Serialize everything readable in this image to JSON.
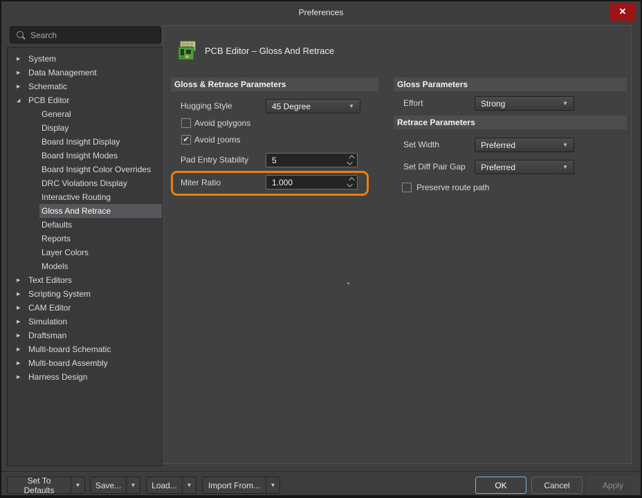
{
  "window": {
    "title": "Preferences"
  },
  "icons": {
    "close": "✕",
    "tree_collapsed": "▶",
    "tree_expanded": "◢",
    "dropdown_arrow": "▼",
    "check": "✔"
  },
  "colors": {
    "annotation_orange": "#e8820f",
    "close_button_red": "#9c1414",
    "selection_gray": "#56575b",
    "panel_bg": "#414141",
    "sidebar_bg": "#393939",
    "section_band_bg": "#4d4d4d",
    "ok_border_blue": "#85b0ce"
  },
  "sidebar": {
    "search_placeholder": "Search",
    "items": [
      {
        "label": "System",
        "level": 0,
        "state": "collapsed"
      },
      {
        "label": "Data Management",
        "level": 0,
        "state": "collapsed"
      },
      {
        "label": "Schematic",
        "level": 0,
        "state": "collapsed"
      },
      {
        "label": "PCB Editor",
        "level": 0,
        "state": "expanded"
      },
      {
        "label": "General",
        "level": 1
      },
      {
        "label": "Display",
        "level": 1
      },
      {
        "label": "Board Insight Display",
        "level": 1
      },
      {
        "label": "Board Insight Modes",
        "level": 1
      },
      {
        "label": "Board Insight Color Overrides",
        "level": 1
      },
      {
        "label": "DRC Violations Display",
        "level": 1
      },
      {
        "label": "Interactive Routing",
        "level": 1
      },
      {
        "label": "Gloss And Retrace",
        "level": 1,
        "selected": true
      },
      {
        "label": "Defaults",
        "level": 1
      },
      {
        "label": "Reports",
        "level": 1
      },
      {
        "label": "Layer Colors",
        "level": 1
      },
      {
        "label": "Models",
        "level": 1
      },
      {
        "label": "Text Editors",
        "level": 0,
        "state": "collapsed"
      },
      {
        "label": "Scripting System",
        "level": 0,
        "state": "collapsed"
      },
      {
        "label": "CAM Editor",
        "level": 0,
        "state": "collapsed"
      },
      {
        "label": "Simulation",
        "level": 0,
        "state": "collapsed"
      },
      {
        "label": "Draftsman",
        "level": 0,
        "state": "collapsed"
      },
      {
        "label": "Multi-board Schematic",
        "level": 0,
        "state": "collapsed"
      },
      {
        "label": "Multi-board Assembly",
        "level": 0,
        "state": "collapsed"
      },
      {
        "label": "Harness Design",
        "level": 0,
        "state": "collapsed"
      }
    ]
  },
  "header": {
    "title": "PCB Editor – Gloss And Retrace"
  },
  "left_panel": {
    "section_title": "Gloss & Retrace Parameters",
    "hugging_style": {
      "label": "Hugging Style",
      "value": "45 Degree"
    },
    "avoid_polygons": {
      "pre": "Avoid ",
      "accel": "p",
      "post": "olygons",
      "checked": false
    },
    "avoid_rooms": {
      "pre": "Avoid ",
      "accel": "r",
      "post": "ooms",
      "checked": true
    },
    "pad_entry_stability": {
      "label": "Pad Entry Stability",
      "value": "5"
    },
    "miter_ratio": {
      "label": "Miter Ratio",
      "value": "1.000",
      "highlighted": true
    }
  },
  "right_panel": {
    "gloss_section_title": "Gloss Parameters",
    "effort": {
      "label": "Effort",
      "value": "Strong"
    },
    "retrace_section_title": "Retrace Parameters",
    "set_width": {
      "label": "Set Width",
      "value": "Preferred"
    },
    "set_diff_pair_gap": {
      "label": "Set Diff Pair Gap",
      "value": "Preferred"
    },
    "preserve_route_path": {
      "label": "Preserve route path",
      "checked": false
    }
  },
  "footer": {
    "set_to_defaults": "Set To Defaults",
    "save": "Save...",
    "load": "Load...",
    "import_from": "Import From...",
    "ok": "OK",
    "cancel": "Cancel",
    "apply": "Apply"
  }
}
